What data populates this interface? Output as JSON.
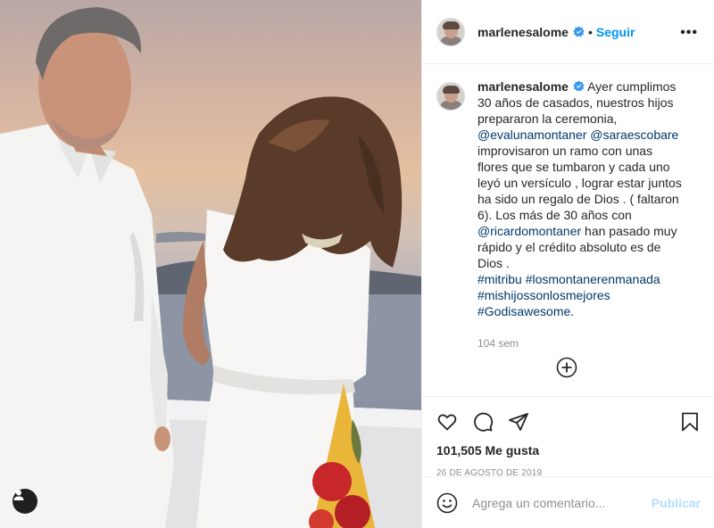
{
  "post": {
    "username": "marlenesalome",
    "follow_label": "Seguir",
    "separator": "•",
    "more_label": "•••",
    "caption_text": "Ayer cumplimos 30 años de casados, nuestros hijos prepararon la ceremonia,",
    "mention_1": "@evalunamontaner",
    "mention_2": "@saraescobare",
    "caption_text_2": "improvisaron un ramo con unas flores que se tumbaron y cada uno leyó un versículo , lograr estar juntos ha sido un regalo de Dios . ( faltaron 6). Los más de 30 años con",
    "mention_3": "@ricardomontaner",
    "caption_text_3": "han pasado muy rápido y el crédito absoluto es de Dios .",
    "hashtag_1": "#mitribu",
    "hashtag_2": "#losmontanerenmanada",
    "hashtag_3": "#mishijossonlosmejores",
    "hashtag_4": "#Godisawesome",
    "caption_end": ".",
    "time_ago": "104 sem",
    "likes": "101,505 Me gusta",
    "date": "26 de agosto de 2019"
  },
  "comment": {
    "placeholder": "Agrega un comentario...",
    "publish_label": "Publicar"
  },
  "colors": {
    "link_blue": "#0095f6",
    "tag_blue": "#00376b",
    "muted": "#8e8e8e",
    "publish_disabled": "#b2dffc"
  },
  "icons": [
    "verified-badge-icon",
    "more-options-icon",
    "load-more-comments-icon",
    "heart-icon",
    "comment-icon",
    "share-icon",
    "save-bookmark-icon",
    "emoji-icon",
    "user-tag-icon"
  ]
}
